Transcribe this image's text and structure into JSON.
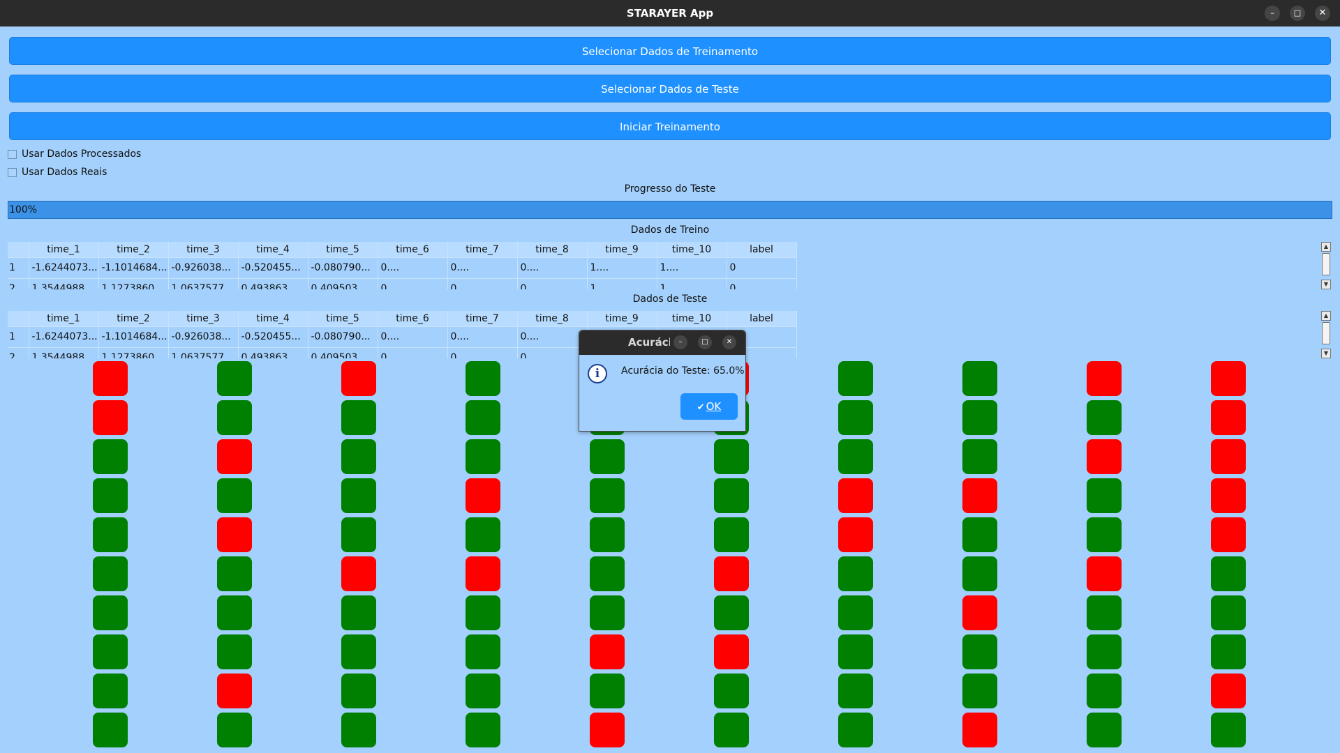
{
  "window": {
    "title": "STARAYER App",
    "min_label": "–",
    "max_label": "□",
    "close_label": "✕"
  },
  "buttons": {
    "train": "Selecionar Dados de Treinamento",
    "test": "Selecionar Dados de Teste",
    "start": "Iniciar Treinamento"
  },
  "checkboxes": {
    "processed": "Usar Dados Processados",
    "real": "Usar Dados Reais"
  },
  "progress": {
    "label": "Progresso do Teste",
    "value_text": "100%",
    "value": 1.0
  },
  "train_table": {
    "label": "Dados de Treino",
    "headers": [
      "time_1",
      "time_2",
      "time_3",
      "time_4",
      "time_5",
      "time_6",
      "time_7",
      "time_8",
      "time_9",
      "time_10",
      "label"
    ],
    "rows": [
      [
        "1",
        "-1.6244073...",
        "-1.1014684...",
        "-0.926038...",
        "-0.520455...",
        "-0.080790...",
        "0....",
        "0....",
        "0....",
        "1....",
        "1....",
        "0"
      ],
      [
        "2",
        "1.3544988",
        "1.1273860",
        "1.0637577",
        "0.493863",
        "0.409503",
        "0",
        "0",
        "0",
        "1",
        "1",
        "0"
      ]
    ]
  },
  "test_table": {
    "label": "Dados de Teste",
    "headers": [
      "time_1",
      "time_2",
      "time_3",
      "time_4",
      "time_5",
      "time_6",
      "time_7",
      "time_8",
      "time_9",
      "time_10",
      "label"
    ],
    "rows": [
      [
        "1",
        "-1.6244073...",
        "-1.1014684...",
        "-0.926038...",
        "-0.520455...",
        "-0.080790...",
        "0....",
        "0....",
        "0....",
        "",
        "",
        ""
      ],
      [
        "2",
        "1.3544988",
        "1.1273860",
        "1.0637577",
        "0.493863",
        "0.409503",
        "0",
        "0",
        "0",
        "",
        "",
        ""
      ]
    ]
  },
  "results_grid": {
    "colors": {
      "correct": "#008000",
      "wrong": "#ff0000"
    },
    "columns": [
      [
        "bad",
        "bad",
        "ok",
        "ok",
        "ok",
        "ok",
        "ok",
        "ok",
        "ok",
        "ok"
      ],
      [
        "ok",
        "ok",
        "bad",
        "ok",
        "bad",
        "ok",
        "ok",
        "ok",
        "bad",
        "ok"
      ],
      [
        "bad",
        "ok",
        "ok",
        "ok",
        "ok",
        "bad",
        "ok",
        "ok",
        "ok",
        "ok"
      ],
      [
        "ok",
        "ok",
        "ok",
        "bad",
        "ok",
        "bad",
        "ok",
        "ok",
        "ok",
        "ok"
      ],
      [
        "ok",
        "ok",
        "ok",
        "ok",
        "ok",
        "ok",
        "ok",
        "bad",
        "ok",
        "bad"
      ],
      [
        "bad",
        "ok",
        "ok",
        "ok",
        "ok",
        "bad",
        "ok",
        "bad",
        "ok",
        "ok"
      ],
      [
        "ok",
        "ok",
        "ok",
        "bad",
        "bad",
        "ok",
        "ok",
        "ok",
        "ok",
        "ok"
      ],
      [
        "ok",
        "ok",
        "ok",
        "bad",
        "ok",
        "ok",
        "bad",
        "ok",
        "ok",
        "bad"
      ],
      [
        "bad",
        "ok",
        "bad",
        "ok",
        "ok",
        "bad",
        "ok",
        "ok",
        "ok",
        "ok"
      ],
      [
        "bad",
        "bad",
        "bad",
        "bad",
        "bad",
        "ok",
        "ok",
        "ok",
        "bad",
        "ok"
      ]
    ]
  },
  "dialog": {
    "title": "Acurácia",
    "message": "Acurácia do Teste: 65.0%",
    "ok_label": "OK",
    "min_label": "–",
    "max_label": "□",
    "close_label": "✕"
  }
}
